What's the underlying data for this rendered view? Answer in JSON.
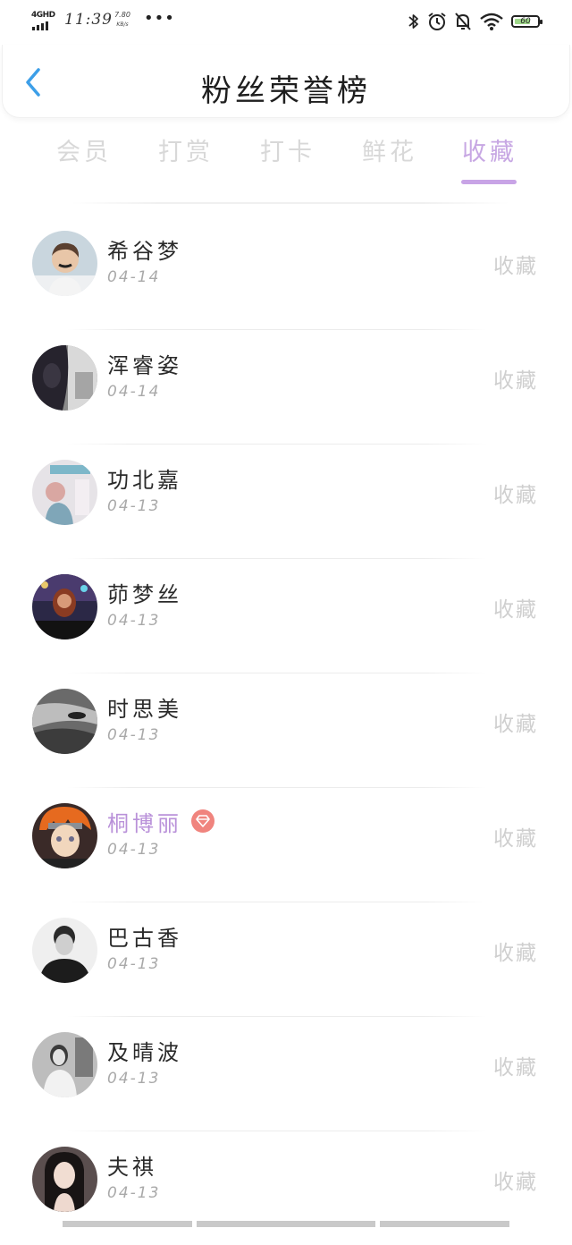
{
  "status_bar": {
    "network": "4GHD",
    "time": "11:39",
    "speed_value": "7.80",
    "speed_unit": "KB/s",
    "more": "•••",
    "battery": "60"
  },
  "header": {
    "title": "粉丝荣誉榜"
  },
  "tabs": [
    {
      "label": "会员",
      "active": false
    },
    {
      "label": "打赏",
      "active": false
    },
    {
      "label": "打卡",
      "active": false
    },
    {
      "label": "鲜花",
      "active": false
    },
    {
      "label": "收藏",
      "active": true
    }
  ],
  "list": [
    {
      "name": "希谷梦",
      "date": "04-14",
      "action": "收藏",
      "vip": false
    },
    {
      "name": "浑睿姿",
      "date": "04-14",
      "action": "收藏",
      "vip": false
    },
    {
      "name": "功北嘉",
      "date": "04-13",
      "action": "收藏",
      "vip": false
    },
    {
      "name": "茆梦丝",
      "date": "04-13",
      "action": "收藏",
      "vip": false
    },
    {
      "name": "时思美",
      "date": "04-13",
      "action": "收藏",
      "vip": false
    },
    {
      "name": "桐博丽",
      "date": "04-13",
      "action": "收藏",
      "vip": true
    },
    {
      "name": "巴古香",
      "date": "04-13",
      "action": "收藏",
      "vip": false
    },
    {
      "name": "及晴波",
      "date": "04-13",
      "action": "收藏",
      "vip": false
    },
    {
      "name": "夫祺",
      "date": "04-13",
      "action": "收藏",
      "vip": false
    }
  ],
  "colors": {
    "accent": "#c8a4e6",
    "vip_name": "#b991d9",
    "vip_badge": "#f0847e",
    "back_arrow": "#3d9fe8",
    "tab_inactive": "#d8d8d8",
    "muted_text": "#a9a9a9"
  },
  "icons": {
    "back": "chevron-left-icon",
    "bluetooth": "bluetooth-icon",
    "alarm": "alarm-icon",
    "mute": "bell-off-icon",
    "wifi": "wifi-icon",
    "battery": "battery-icon",
    "vip": "diamond-icon"
  }
}
